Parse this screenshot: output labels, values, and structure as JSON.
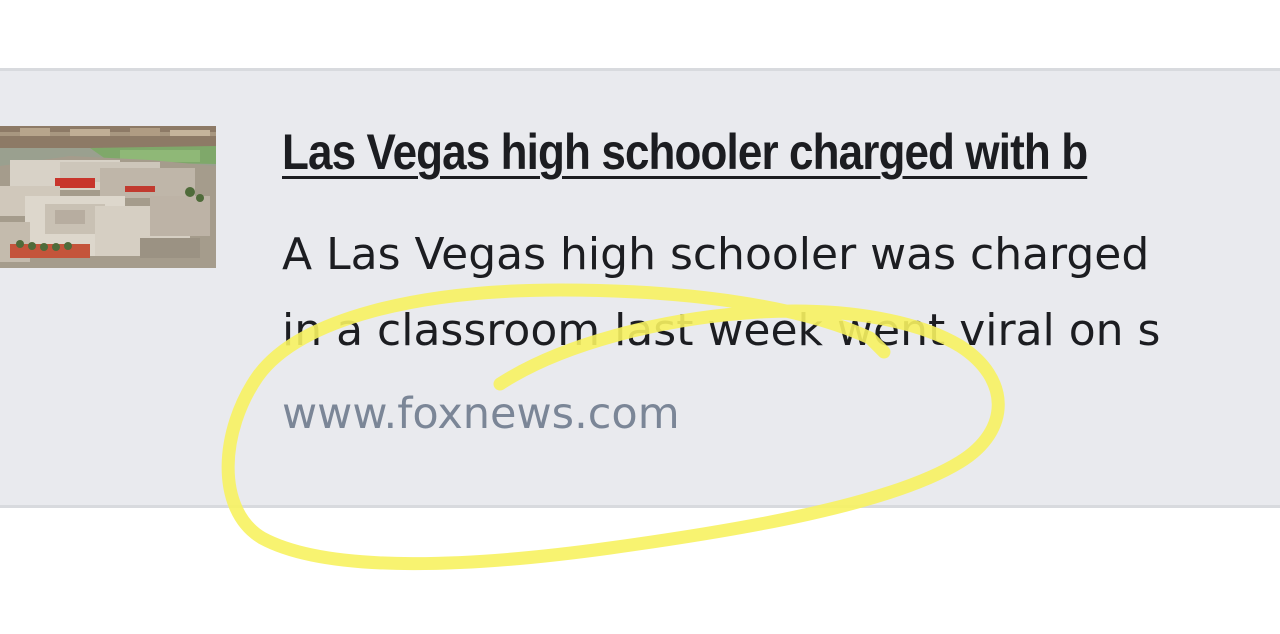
{
  "link_preview": {
    "title": "Las Vegas high schooler charged with b",
    "description_lines": [
      "A Las Vegas high schooler was charged",
      "in a classroom last week went viral on s"
    ],
    "domain": "www.foxnews.com"
  },
  "annotation": {
    "type": "freehand-circle",
    "color": "#f7f260"
  },
  "colors": {
    "card_background": "#e9eaee",
    "title": "#1c1d21",
    "domain": "#7b8697"
  }
}
